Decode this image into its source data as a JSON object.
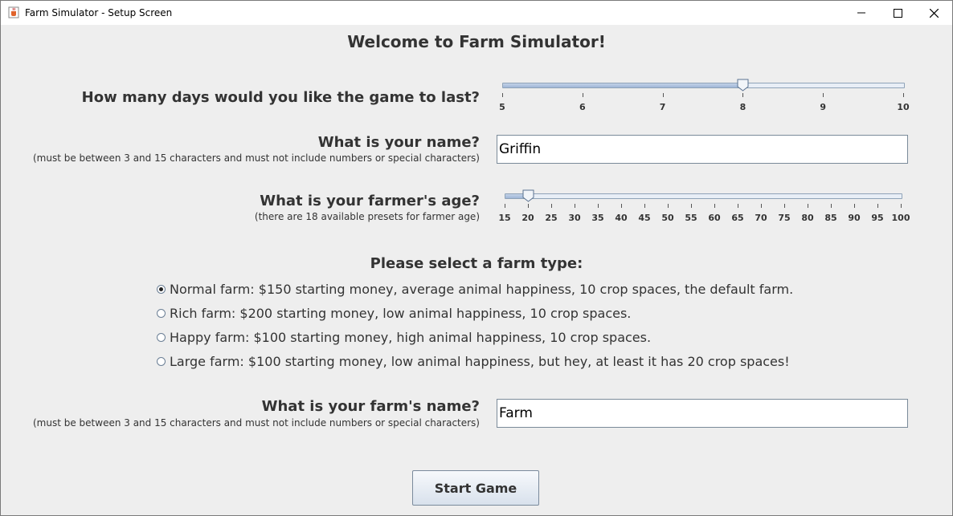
{
  "window": {
    "title": "Farm Simulator - Setup Screen",
    "icon": "java-cup-icon",
    "controls": [
      "minimize",
      "maximize",
      "close"
    ]
  },
  "heading": "Welcome to Farm Simulator!",
  "days": {
    "label": "How many days would you like the game to last?",
    "min": 5,
    "max": 10,
    "value": 8,
    "ticks": [
      "5",
      "6",
      "7",
      "8",
      "9",
      "10"
    ]
  },
  "name": {
    "label": "What is your name?",
    "note": "(must be between 3 and 15 characters and must not include numbers or special characters)",
    "value": "Griffin"
  },
  "age": {
    "label": "What is your farmer's age?",
    "note": "(there are 18 available presets for farmer age)",
    "min": 15,
    "max": 100,
    "value": 20,
    "ticks": [
      "15",
      "20",
      "25",
      "30",
      "35",
      "40",
      "45",
      "50",
      "55",
      "60",
      "65",
      "70",
      "75",
      "80",
      "85",
      "90",
      "95",
      "100"
    ]
  },
  "farm_type": {
    "label": "Please select a farm type:",
    "selected_index": 0,
    "options": [
      "Normal farm: $150 starting money, average animal happiness, 10 crop spaces, the default farm.",
      "Rich farm: $200 starting money, low animal happiness, 10 crop spaces.",
      "Happy farm: $100 starting money, high animal happiness, 10 crop spaces.",
      "Large farm: $100 starting money, low animal happiness, but hey, at least it has 20 crop spaces!"
    ]
  },
  "farm_name": {
    "label": "What is your farm's name?",
    "note": "(must be between 3 and 15 characters and must not include numbers or special characters)",
    "value": "Farm"
  },
  "start_button": "Start Game",
  "colors": {
    "accent": "#9fb6d6",
    "background": "#eeeeee",
    "titlebar": "#ffffff"
  }
}
